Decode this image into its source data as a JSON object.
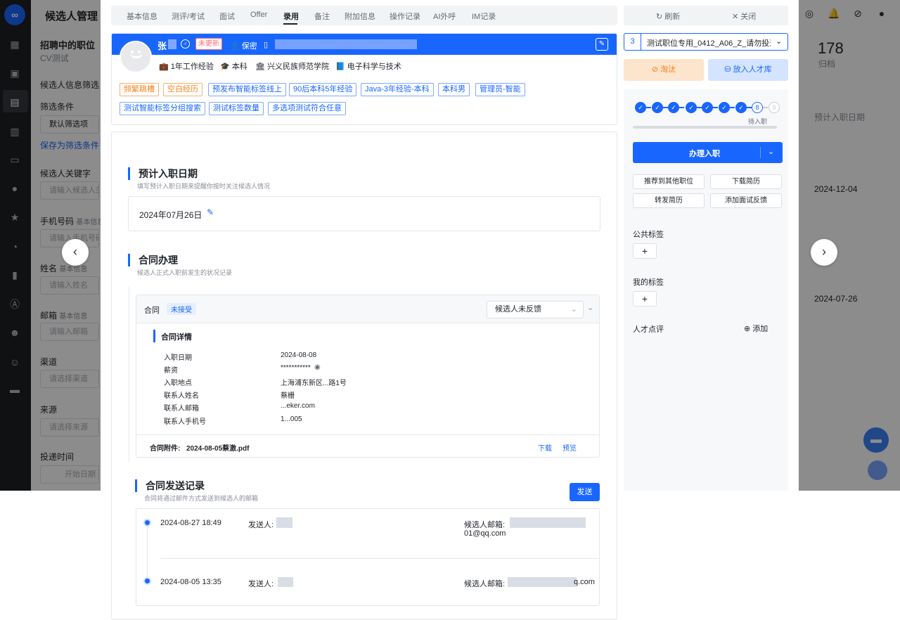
{
  "app": {
    "title": "候选人管理",
    "sidebar": {
      "section_title": "招聘中的职位",
      "section_sub": "CV测试",
      "filter_title": "候选人信息筛选",
      "filter_cond": "筛选条件",
      "default_filter": "默认筛选项",
      "save_filter": "保存为筛选条件",
      "keyword_label": "候选人关键字",
      "keyword_placeholder": "请输入候选人关键字",
      "phone_label": "手机号码",
      "phone_sub": "基本信息",
      "phone_placeholder": "请输入手机号码",
      "name_label": "姓名",
      "name_sub": "基本信息",
      "name_placeholder": "请输入姓名",
      "email_label": "邮箱",
      "email_sub": "基本信息",
      "email_placeholder": "请输入邮箱",
      "channel_label": "渠道",
      "channel_placeholder": "请选择渠道",
      "source_label": "来源",
      "source_placeholder": "请选择来源",
      "time_label": "投递时间",
      "time_placeholder": "开始日期"
    },
    "right_bg": {
      "count": "178",
      "count_label": "归档",
      "col_header": "预计入职日期",
      "date1": "2024-12-04",
      "date2": "2024-07-26"
    }
  },
  "tabs": [
    "基本信息",
    "测评/考试",
    "面试",
    "Offer",
    "录用",
    "备注",
    "附加信息",
    "操作记录",
    "AI外呼",
    "IM记录"
  ],
  "actions": {
    "refresh": "刷新",
    "close": "关闭"
  },
  "profile": {
    "name": "张",
    "status_badge": "未更新",
    "privacy": "保密",
    "experience": "1年工作经验",
    "degree": "本科",
    "school": "兴义民族师范学院",
    "major": "电子科学与技术",
    "tags_row1": [
      {
        "text": "频繁跳槽",
        "color": "orange"
      },
      {
        "text": "空白经历",
        "color": "orange"
      },
      {
        "text": "预发布智能标签线上",
        "color": "blue"
      },
      {
        "text": "90后本科5年经验",
        "color": "blue"
      },
      {
        "text": "Java-3年经验-本科",
        "color": "blue"
      },
      {
        "text": "本科男",
        "color": "blue"
      },
      {
        "text": "管理员-智能",
        "color": "blue"
      }
    ],
    "tags_row2": [
      {
        "text": "测试智能标签分组搜索",
        "color": "blue"
      },
      {
        "text": "测试标签数量",
        "color": "blue"
      },
      {
        "text": "多选项测试符合任意",
        "color": "blue"
      }
    ]
  },
  "onboard_date": {
    "title": "预计入职日期",
    "subtitle": "填写预计入职日期来提醒你按时关注候选人情况",
    "value": "2024年07月26日"
  },
  "contract": {
    "title": "合同办理",
    "subtitle": "候选人正式入职前发生的状况记录",
    "label": "合同",
    "status": "未接受",
    "feedback_select": "候选人未反馈",
    "details_title": "合同详情",
    "rows": [
      {
        "label": "入职日期",
        "value": "2024-08-08"
      },
      {
        "label": "薪资",
        "value": "***********"
      },
      {
        "label": "入职地点",
        "value": "上海浦东新区...路1号"
      },
      {
        "label": "联系人姓名",
        "value": "蔡栅"
      },
      {
        "label": "联系人邮箱",
        "value": "...eker.com"
      },
      {
        "label": "联系人手机号",
        "value": "1...005"
      }
    ],
    "attachment_label": "合同附件:",
    "attachment_name": "2024-08-05蔡激.pdf",
    "download": "下载",
    "preview": "预览"
  },
  "send_records": {
    "title": "合同发送记录",
    "subtitle": "合同将通过邮件方式发送到候选人的邮箱",
    "send_button": "发送",
    "records": [
      {
        "time": "2024-08-27 18:49",
        "sender_label": "发送人:",
        "email_label": "候选人邮箱:",
        "email_tail": "01@qq.com"
      },
      {
        "time": "2024-08-05 13:35",
        "sender_label": "发送人:",
        "email_label": "候选人邮箱:",
        "email_tail": "q.com"
      }
    ]
  },
  "right_panel": {
    "position_number": "3",
    "position_name": "测试职位专用_0412_A06_Z_请勿投递",
    "reject": "淘汰",
    "talent_pool": "放入人才库",
    "steps": [
      "✓",
      "✓",
      "✓",
      "✓",
      "✓",
      "✓",
      "✓",
      "8",
      "9"
    ],
    "step_status": "待入职",
    "primary_action": "办理入职",
    "btn_recommend": "推荐到其他职位",
    "btn_download": "下载简历",
    "btn_forward": "转发简历",
    "btn_feedback": "添加面试反馈",
    "public_tags": "公共标签",
    "my_tags": "我的标签",
    "talent_review": "人才点评",
    "add": "添加"
  },
  "colors": {
    "accent": "#1966ff",
    "reject_bg": "#fde4cc",
    "talent_bg": "#d4e4ff"
  }
}
